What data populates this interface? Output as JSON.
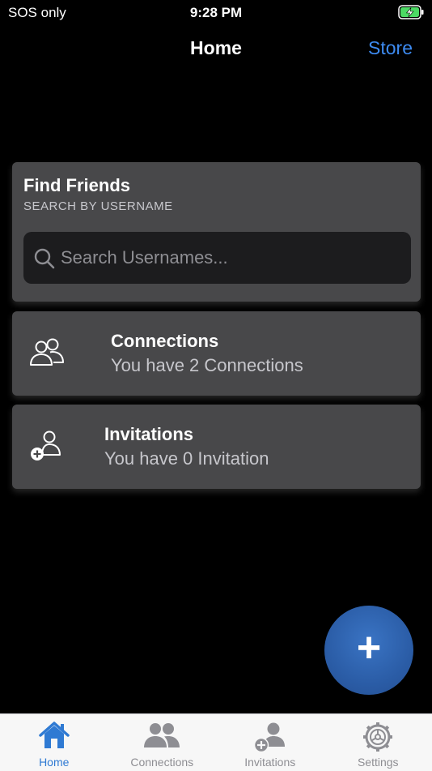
{
  "status_bar": {
    "carrier": "SOS only",
    "time": "9:28 PM",
    "battery_color": "#4cd964"
  },
  "nav": {
    "title": "Home",
    "store_label": "Store"
  },
  "find_friends": {
    "title": "Find Friends",
    "subtitle": "SEARCH BY USERNAME",
    "search_placeholder": "Search Usernames...",
    "search_value": ""
  },
  "connections": {
    "title": "Connections",
    "subtitle": "You have 2 Connections",
    "icon": "people-icon"
  },
  "invitations": {
    "title": "Invitations",
    "subtitle": "You have 0 Invitation",
    "icon": "add-person-icon"
  },
  "fab": {
    "label": "+",
    "color": "#2b5da7"
  },
  "tab_bar": {
    "items": [
      {
        "label": "Home",
        "icon": "home-icon",
        "active": true
      },
      {
        "label": "Connections",
        "icon": "people-icon",
        "active": false
      },
      {
        "label": "Invitations",
        "icon": "add-person-icon",
        "active": false
      },
      {
        "label": "Settings",
        "icon": "gear-icon",
        "active": false
      }
    ],
    "active_color": "#2f7ad3",
    "inactive_color": "#8e8e93"
  }
}
